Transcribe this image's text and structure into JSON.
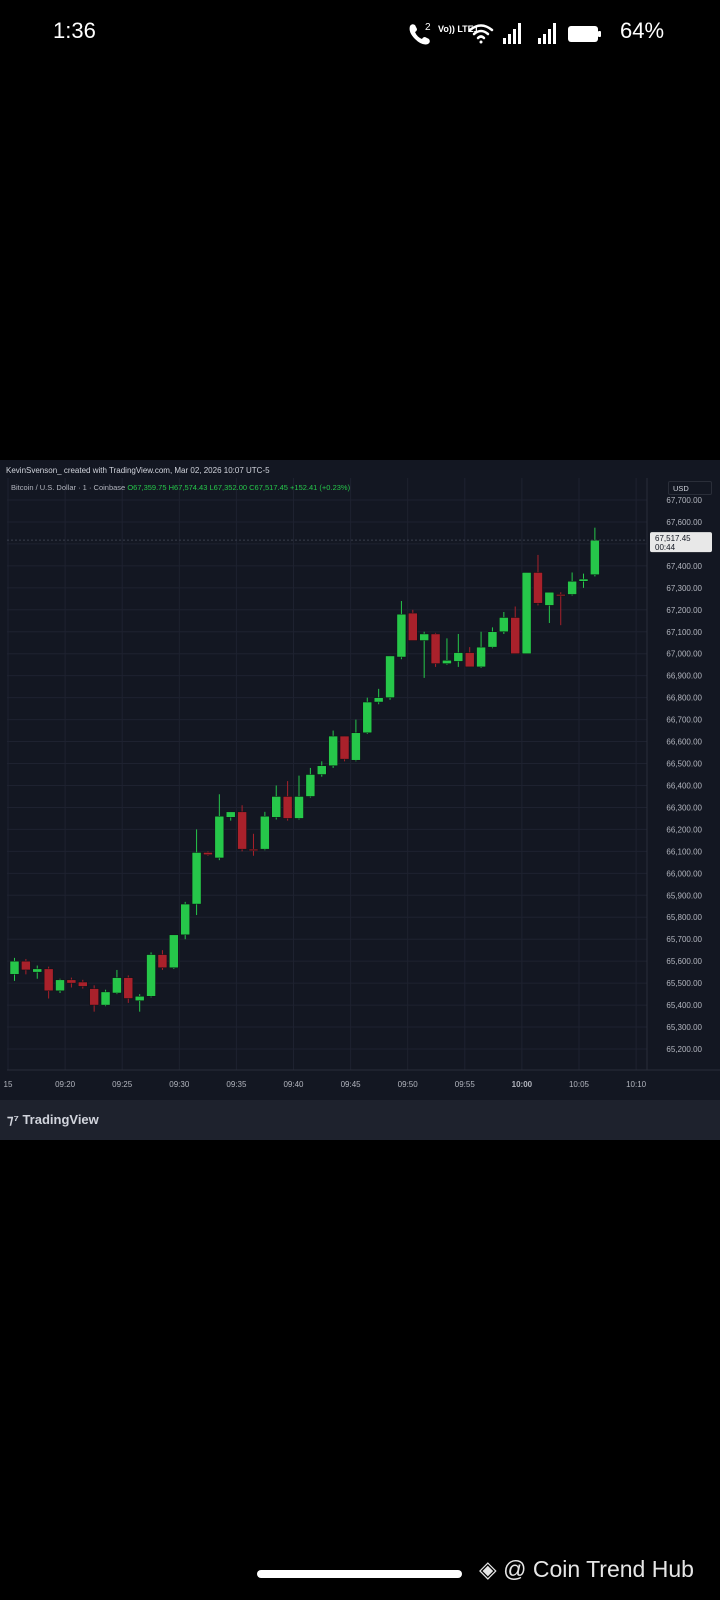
{
  "status_bar": {
    "time": "1:36",
    "volte_label": "Vo)) LTE1",
    "call_badge": "2",
    "battery": "64%"
  },
  "header": {
    "credit": "KevinSvenson_ created with TradingView.com, Mar 02, 2026 10:07 UTC-5",
    "symbol": "Bitcoin / U.S. Dollar · 1 · Coinbase",
    "open": "O67,359.75",
    "high": "H67,574.43",
    "low": "L67,352.00",
    "close": "C67,517.45",
    "change": "+152.41 (+0.23%)"
  },
  "currency": "USD",
  "price_tag": {
    "price": "67,517.45",
    "countdown": "00:44"
  },
  "footer": {
    "brand": "TradingView",
    "watermark": "@ Coin Trend Hub"
  },
  "colors": {
    "up": "#26c74a",
    "down": "#a9212b",
    "background": "#131722",
    "grid": "#1e2230"
  },
  "chart_data": {
    "type": "candlestick",
    "symbol": "BTC/USD",
    "interval": "1",
    "exchange": "Coinbase",
    "ylim": [
      65100,
      67800
    ],
    "yticks": [
      "67,700.00",
      "67,600.00",
      "67,500.00",
      "67,400.00",
      "67,300.00",
      "67,200.00",
      "67,100.00",
      "67,000.00",
      "66,900.00",
      "66,800.00",
      "66,700.00",
      "66,600.00",
      "66,500.00",
      "66,400.00",
      "66,300.00",
      "66,200.00",
      "66,100.00",
      "66,000.00",
      "65,900.00",
      "65,800.00",
      "65,700.00",
      "65,600.00",
      "65,500.00",
      "65,400.00",
      "65,300.00",
      "65,200.00"
    ],
    "xticks": [
      "15",
      "09:20",
      "09:25",
      "09:30",
      "09:35",
      "09:40",
      "09:45",
      "09:50",
      "09:55",
      "10:00",
      "10:05",
      "10:10"
    ],
    "candles": [
      {
        "o": 65540,
        "h": 65615,
        "l": 65510,
        "c": 65600
      },
      {
        "o": 65600,
        "h": 65610,
        "l": 65540,
        "c": 65560
      },
      {
        "o": 65550,
        "h": 65580,
        "l": 65520,
        "c": 65565
      },
      {
        "o": 65565,
        "h": 65575,
        "l": 65430,
        "c": 65465
      },
      {
        "o": 65465,
        "h": 65520,
        "l": 65455,
        "c": 65515
      },
      {
        "o": 65515,
        "h": 65525,
        "l": 65480,
        "c": 65500
      },
      {
        "o": 65505,
        "h": 65515,
        "l": 65475,
        "c": 65485
      },
      {
        "o": 65475,
        "h": 65490,
        "l": 65370,
        "c": 65400
      },
      {
        "o": 65400,
        "h": 65470,
        "l": 65395,
        "c": 65460
      },
      {
        "o": 65455,
        "h": 65560,
        "l": 65450,
        "c": 65525
      },
      {
        "o": 65525,
        "h": 65535,
        "l": 65410,
        "c": 65430
      },
      {
        "o": 65420,
        "h": 65450,
        "l": 65370,
        "c": 65440
      },
      {
        "o": 65440,
        "h": 65640,
        "l": 65435,
        "c": 65630
      },
      {
        "o": 65630,
        "h": 65650,
        "l": 65560,
        "c": 65570
      },
      {
        "o": 65570,
        "h": 65720,
        "l": 65565,
        "c": 65720
      },
      {
        "o": 65720,
        "h": 65870,
        "l": 65700,
        "c": 65860
      },
      {
        "o": 65860,
        "h": 66200,
        "l": 65810,
        "c": 66095
      },
      {
        "o": 66095,
        "h": 66100,
        "l": 66080,
        "c": 66085
      },
      {
        "o": 66070,
        "h": 66360,
        "l": 66060,
        "c": 66260
      },
      {
        "o": 66255,
        "h": 66280,
        "l": 66240,
        "c": 66280
      },
      {
        "o": 66280,
        "h": 66310,
        "l": 66100,
        "c": 66110
      },
      {
        "o": 66110,
        "h": 66180,
        "l": 66080,
        "c": 66105
      },
      {
        "o": 66110,
        "h": 66280,
        "l": 66105,
        "c": 66260
      },
      {
        "o": 66255,
        "h": 66400,
        "l": 66245,
        "c": 66350
      },
      {
        "o": 66350,
        "h": 66420,
        "l": 66240,
        "c": 66250
      },
      {
        "o": 66250,
        "h": 66445,
        "l": 66245,
        "c": 66350
      },
      {
        "o": 66350,
        "h": 66480,
        "l": 66345,
        "c": 66450
      },
      {
        "o": 66450,
        "h": 66510,
        "l": 66440,
        "c": 66490
      },
      {
        "o": 66490,
        "h": 66650,
        "l": 66480,
        "c": 66625
      },
      {
        "o": 66625,
        "h": 66625,
        "l": 66510,
        "c": 66520
      },
      {
        "o": 66515,
        "h": 66700,
        "l": 66510,
        "c": 66640
      },
      {
        "o": 66640,
        "h": 66800,
        "l": 66635,
        "c": 66780
      },
      {
        "o": 66780,
        "h": 66840,
        "l": 66770,
        "c": 66800
      },
      {
        "o": 66800,
        "h": 66990,
        "l": 66790,
        "c": 66990
      },
      {
        "o": 66985,
        "h": 67240,
        "l": 66975,
        "c": 67180
      },
      {
        "o": 67185,
        "h": 67200,
        "l": 67070,
        "c": 67060
      },
      {
        "o": 67060,
        "h": 67100,
        "l": 66890,
        "c": 67090
      },
      {
        "o": 67090,
        "h": 67095,
        "l": 66940,
        "c": 66955
      },
      {
        "o": 66955,
        "h": 67070,
        "l": 66950,
        "c": 66970
      },
      {
        "o": 66965,
        "h": 67090,
        "l": 66940,
        "c": 67005
      },
      {
        "o": 67005,
        "h": 67030,
        "l": 66950,
        "c": 66940
      },
      {
        "o": 66940,
        "h": 67100,
        "l": 66935,
        "c": 67030
      },
      {
        "o": 67030,
        "h": 67120,
        "l": 67025,
        "c": 67100
      },
      {
        "o": 67100,
        "h": 67190,
        "l": 67090,
        "c": 67165
      },
      {
        "o": 67165,
        "h": 67215,
        "l": 67000,
        "c": 67000
      },
      {
        "o": 67000,
        "h": 67370,
        "l": 67000,
        "c": 67370
      },
      {
        "o": 67370,
        "h": 67450,
        "l": 67220,
        "c": 67230
      },
      {
        "o": 67220,
        "h": 67280,
        "l": 67140,
        "c": 67280
      },
      {
        "o": 67270,
        "h": 67280,
        "l": 67130,
        "c": 67265
      },
      {
        "o": 67270,
        "h": 67370,
        "l": 67265,
        "c": 67330
      },
      {
        "o": 67330,
        "h": 67365,
        "l": 67300,
        "c": 67340
      },
      {
        "o": 67360,
        "h": 67574,
        "l": 67352,
        "c": 67517
      }
    ]
  }
}
